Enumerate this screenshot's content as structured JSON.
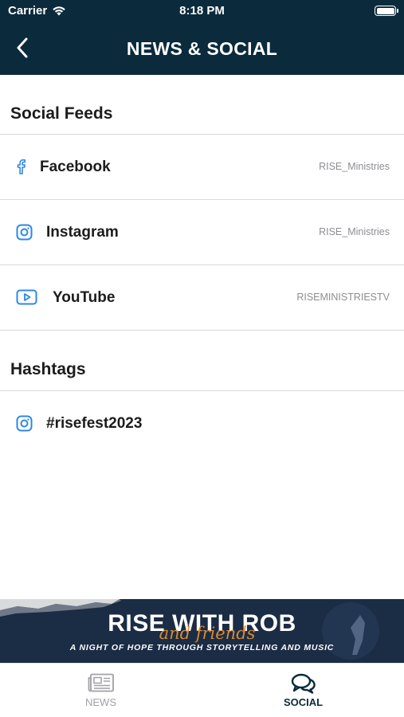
{
  "status_bar": {
    "carrier": "Carrier",
    "time": "8:18 PM"
  },
  "navbar": {
    "title": "NEWS & SOCIAL"
  },
  "social_feeds": {
    "title": "Social Feeds",
    "items": [
      {
        "label": "Facebook",
        "handle": "RISE_Ministries",
        "icon": "facebook-icon"
      },
      {
        "label": "Instagram",
        "handle": "RISE_Ministries",
        "icon": "instagram-icon"
      },
      {
        "label": "YouTube",
        "handle": "RISEMINISTRIESTV",
        "icon": "youtube-icon"
      }
    ]
  },
  "hashtags": {
    "title": "Hashtags",
    "items": [
      {
        "label": "#risefest2023",
        "icon": "instagram-icon"
      }
    ]
  },
  "banner": {
    "title": "RISE WITH ROB",
    "script": "and friends",
    "tagline": "A NIGHT OF HOPE THROUGH STORYTELLING AND MUSIC"
  },
  "tabbar": {
    "tabs": [
      {
        "label": "NEWS",
        "active": false
      },
      {
        "label": "SOCIAL",
        "active": true
      }
    ]
  },
  "colors": {
    "header": "#0b2a3b",
    "icon_accent": "#2f87e6",
    "banner_bg": "#1b2c45",
    "script_orange": "#e58f2e"
  }
}
